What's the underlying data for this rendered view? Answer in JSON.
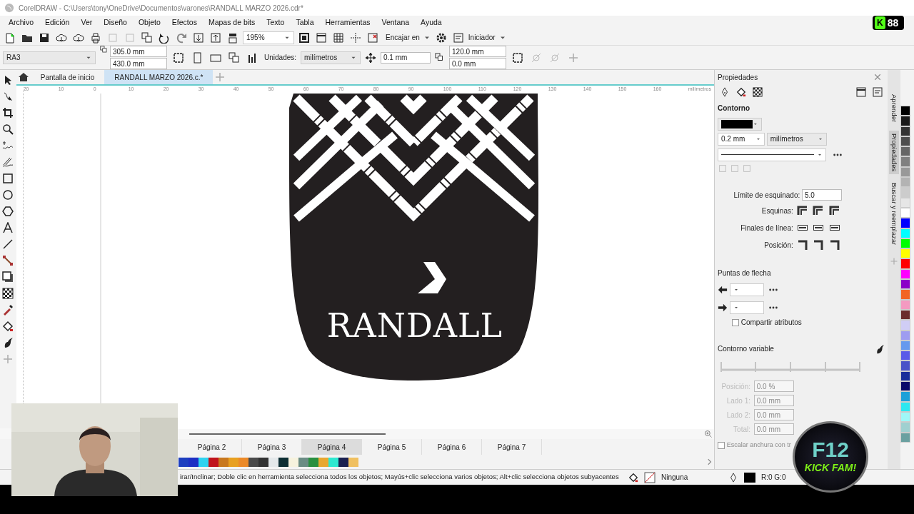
{
  "window": {
    "title": "CorelDRAW - C:\\Users\\tony\\OneDrive\\Documentos\\varones\\RANDALL MARZO 2026.cdr*"
  },
  "overlay_badge": {
    "letter": "K",
    "count": "88"
  },
  "menu": [
    "Archivo",
    "Edición",
    "Ver",
    "Diseño",
    "Objeto",
    "Efectos",
    "Mapas de bits",
    "Texto",
    "Tabla",
    "Herramientas",
    "Ventana",
    "Ayuda"
  ],
  "toolbar": {
    "zoom": "195%",
    "snap": "Encajar en",
    "launcher": "Iniciador"
  },
  "property_bar": {
    "paper": "RA3",
    "width": "305.0 mm",
    "height": "430.0 mm",
    "units_label": "Unidades:",
    "units": "milímetros",
    "nudge": "0.1 mm",
    "dup_x": "120.0 mm",
    "dup_y": "0.0 mm"
  },
  "doc_tabs": [
    {
      "label": "Pantalla de inicio",
      "selected": false
    },
    {
      "label": "RANDALL MARZO 2026.c.*",
      "selected": true
    }
  ],
  "ruler": {
    "labels": [
      "20",
      "10",
      "0",
      "10",
      "20",
      "30",
      "40",
      "50",
      "60",
      "70",
      "80",
      "90",
      "100",
      "110",
      "120",
      "130",
      "140",
      "150",
      "160"
    ],
    "unit": "milímetros"
  },
  "artwork": {
    "text": "RANDALL"
  },
  "page_tabs": [
    {
      "label": "Página 2",
      "selected": false
    },
    {
      "label": "Página 3",
      "selected": false
    },
    {
      "label": "Página 4",
      "selected": true
    },
    {
      "label": "Página 5",
      "selected": false
    },
    {
      "label": "Página 6",
      "selected": false
    },
    {
      "label": "Página 7",
      "selected": false
    }
  ],
  "document_palette": [
    {
      "color": "#1d3fbf"
    },
    {
      "color": "#1e2fc4"
    },
    {
      "color": "#2fd3f0"
    },
    {
      "color": "#c0141c"
    },
    {
      "color": "#c8781e"
    },
    {
      "color": "#e8a020"
    },
    {
      "color": "#ec8a28"
    },
    {
      "color": "#4a4a4a"
    },
    {
      "color": "#333333"
    },
    {
      "color": "#e4e8ea"
    },
    {
      "color": "#0d2e34"
    },
    {
      "color": "#f6f2de"
    },
    {
      "color": "#6a8c84"
    },
    {
      "color": "#2a9040"
    },
    {
      "color": "#e8a830"
    },
    {
      "color": "#2ee8d0"
    },
    {
      "color": "#1a2050"
    },
    {
      "color": "#f0c060"
    }
  ],
  "properties": {
    "title": "Propiedades",
    "section": "Contorno",
    "width": "0.2 mm",
    "units": "milímetros",
    "miter_label": "Límite de esquinado:",
    "miter": "5.0",
    "corners_label": "Esquinas:",
    "caps_label": "Finales de línea:",
    "position_label": "Posición:",
    "arrows_title": "Puntas de flecha",
    "share": {
      "label": "Compartir atributos",
      "checked": false
    },
    "variable_title": "Contorno variable",
    "variable_fields": [
      {
        "label": "Posición:",
        "value": "0.0 %"
      },
      {
        "label": "Lado 1:",
        "value": "0.0 mm"
      },
      {
        "label": "Lado 2:",
        "value": "0.0 mm"
      },
      {
        "label": "Total:",
        "value": "0.0 mm"
      }
    ],
    "scale": {
      "label": "Escalar anchura con tr",
      "checked": false
    }
  },
  "side_tabs": [
    {
      "label": "Aprender",
      "selected": false
    },
    {
      "label": "Propiedades",
      "selected": true
    },
    {
      "label": "Buscar y reemplazar",
      "selected": false
    }
  ],
  "palette": [
    {
      "color": "#000000"
    },
    {
      "color": "#1a1a1a"
    },
    {
      "color": "#333333"
    },
    {
      "color": "#4d4d4d"
    },
    {
      "color": "#666666"
    },
    {
      "color": "#808080"
    },
    {
      "color": "#999999"
    },
    {
      "color": "#b3b3b3"
    },
    {
      "color": "#cccccc"
    },
    {
      "color": "#e6e6e6"
    },
    {
      "color": "#ffffff"
    },
    {
      "color": "#0000ff"
    },
    {
      "color": "#00ffff"
    },
    {
      "color": "#00ff00"
    },
    {
      "color": "#ffff00"
    },
    {
      "color": "#ff0000"
    },
    {
      "color": "#ff00ff"
    },
    {
      "color": "#8b00c8"
    },
    {
      "color": "#f26522"
    },
    {
      "color": "#f49ac1"
    },
    {
      "color": "#6b2c2c"
    },
    {
      "color": "#d0cdf5"
    },
    {
      "color": "#9e9cf0"
    },
    {
      "color": "#6699ee"
    },
    {
      "color": "#5a5ae8"
    },
    {
      "color": "#4a52c8"
    },
    {
      "color": "#1a2e9a"
    },
    {
      "color": "#0a0a6a"
    },
    {
      "color": "#1ca0d8"
    },
    {
      "color": "#2ee8f0"
    },
    {
      "color": "#a0f8f8"
    },
    {
      "color": "#a0d0d0"
    },
    {
      "color": "#6aa0a0"
    }
  ],
  "status": {
    "hint": "irar/Inclinar; Doble clic en herramienta selecciona todos los objetos; Mayús+clic selecciona varios objetos; Alt+clic selecciona objetos subyacentes",
    "fill": "Ninguna",
    "outline": "R:0 G:0"
  },
  "stream_logo": {
    "line1": "F12",
    "line2": "KICK FAM!"
  }
}
